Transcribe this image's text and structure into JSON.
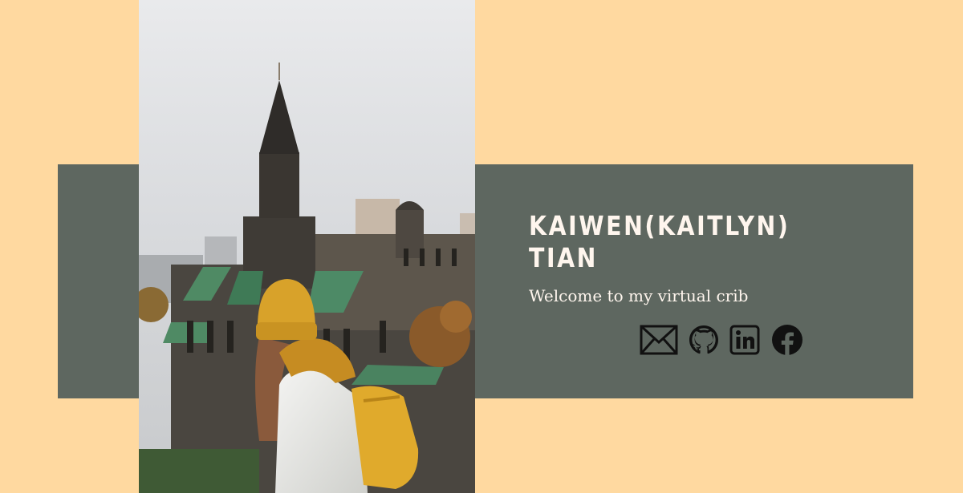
{
  "profile": {
    "name": "KAIWEN(KAITLYN) TIAN",
    "tagline": "Welcome to my virtual crib"
  },
  "social": [
    {
      "icon": "mail-icon",
      "label": "Email"
    },
    {
      "icon": "github-icon",
      "label": "GitHub"
    },
    {
      "icon": "linkedin-icon",
      "label": "LinkedIn"
    },
    {
      "icon": "facebook-icon",
      "label": "Facebook"
    }
  ],
  "colors": {
    "background": "#FFD9A0",
    "band": "#5E6760",
    "text": "#FFF6EE",
    "icon": "#111111"
  }
}
